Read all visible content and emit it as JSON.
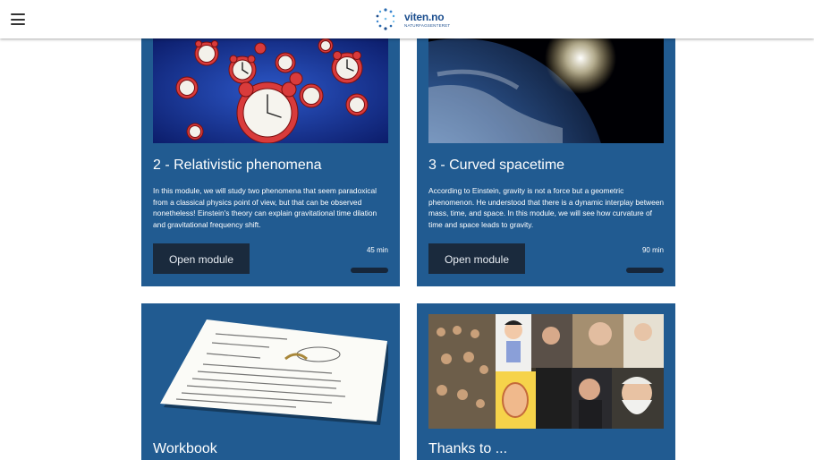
{
  "header": {
    "menu_icon": "hamburger-icon",
    "logo_name": "viten.no",
    "logo_sub": "NATURFAGSENTERET"
  },
  "cards": [
    {
      "title": "2 - Relativistic phenomena",
      "description": "In this module, we will study two phenomena that seem paradoxical from a classical physics point of view, but that can be observed nonetheless! Einstein's theory can explain gravitational time dilation and gravitational frequency shift.",
      "button_label": "Open module",
      "duration": "45 min",
      "image": "clocks-illustration"
    },
    {
      "title": "3 - Curved spacetime",
      "description": "According to Einstein, gravity is not a force but a geometric phenomenon. He understood that there is a dynamic interplay between mass, time, and space. In this module, we will see how curvature of time and space leads to gravity.",
      "button_label": "Open module",
      "duration": "90 min",
      "image": "earth-from-space-photo"
    },
    {
      "title": "Workbook",
      "image": "worksheet-paper-photo"
    },
    {
      "title": "Thanks to ...",
      "image": "contributors-collage-photo"
    }
  ],
  "colors": {
    "card_bg": "#215b91",
    "button_bg": "#1a2a3d",
    "logo_blue": "#1d4f8f"
  }
}
